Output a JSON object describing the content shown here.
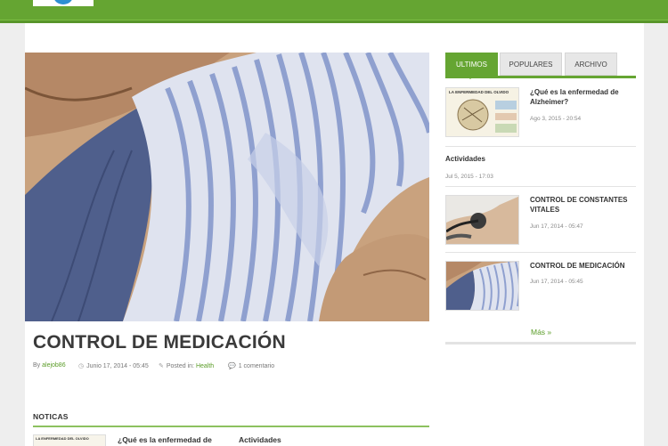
{
  "post": {
    "title": "CONTROL DE MEDICACIÓN",
    "by_label": "By",
    "author": "alejob86",
    "date": "Junio 17, 2014 - 05:45",
    "posted_in_label": "Posted in:",
    "category": "Health",
    "comments": "1 comentario"
  },
  "noticias": {
    "heading": "NOTICAS",
    "items": [
      {
        "title": "¿Qué es la enfermedad de",
        "thumb_caption": "LA ENFERMEDAD DEL OLVIDO"
      },
      {
        "title": "Actividades"
      }
    ]
  },
  "sidebar": {
    "tabs": [
      "ULTIMOS",
      "POPULARES",
      "ARCHIVO"
    ],
    "active_tab": "ULTIMOS",
    "items": [
      {
        "title": "¿Qué es la enfermedad de Alzheimer?",
        "date": "Ago 3, 2015 - 20:54",
        "thumb_caption": "LA ENFERMEDAD DEL OLVIDO"
      },
      {
        "title": "Actividades",
        "date": "Jul 5, 2015 - 17:03"
      },
      {
        "title": "CONTROL DE CONSTANTES VITALES",
        "date": "Jun 17, 2014 - 05:47"
      },
      {
        "title": "CONTROL DE MEDICACIÓN",
        "date": "Jun 17, 2014 - 05:45"
      }
    ],
    "more_link": "Más »"
  },
  "icons": {
    "date": "clock-icon",
    "category": "tag-icon",
    "comments": "comment-icon"
  },
  "colors": {
    "brand_green": "#65a532",
    "link_green": "#5a9c27"
  }
}
